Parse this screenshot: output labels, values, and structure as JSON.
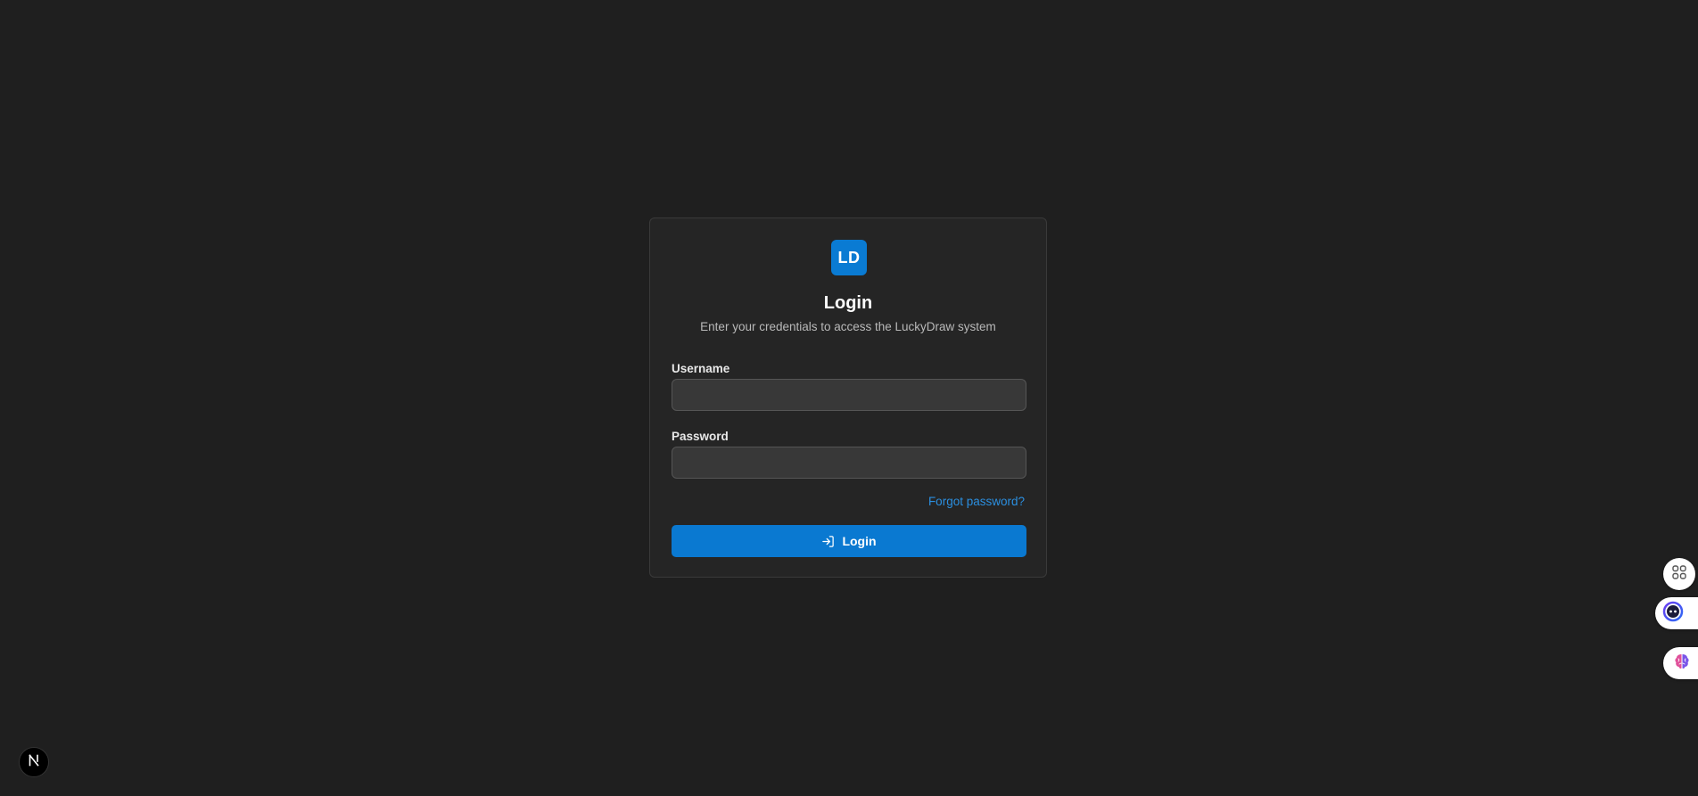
{
  "login_card": {
    "logo_text": "LD",
    "title": "Login",
    "subtitle": "Enter your credentials to access the LuckyDraw system",
    "username": {
      "label": "Username",
      "value": "",
      "placeholder": ""
    },
    "password": {
      "label": "Password",
      "value": "",
      "placeholder": ""
    },
    "forgot_password_link": "Forgot password?",
    "submit_button": {
      "label": "Login",
      "icon": "log-in-icon"
    }
  },
  "side_widgets": {
    "apps_icon": "apps-grid-icon",
    "assistant_icon": "assistant-face-icon",
    "brain_icon": "brain-icon"
  },
  "dev_badge": {
    "icon": "nextjs-icon",
    "text": "N"
  },
  "colors": {
    "background": "#1f1f1f",
    "card": "#252525",
    "accent": "#0a79d1",
    "link": "#2b8fe0",
    "input": "#383838"
  }
}
